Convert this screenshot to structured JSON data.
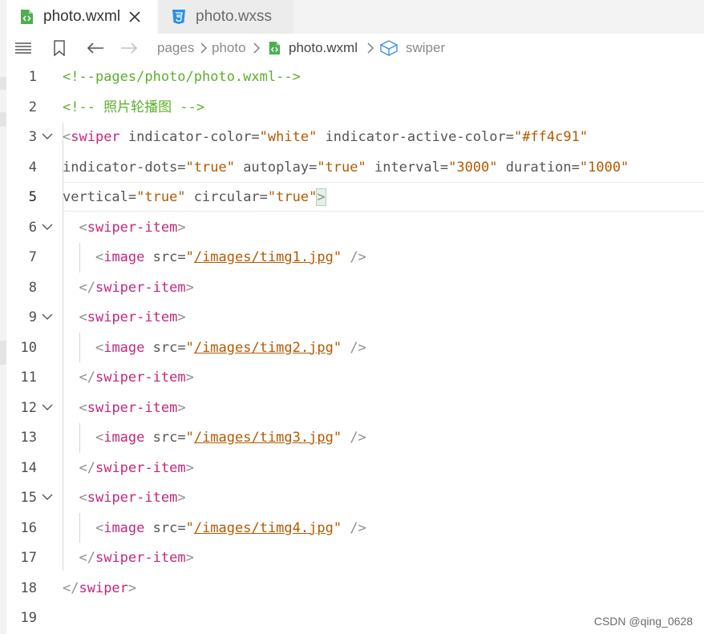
{
  "tabs": [
    {
      "label": "photo.wxml",
      "active": true,
      "icon": "wxml-file-icon"
    },
    {
      "label": "photo.wxss",
      "active": false,
      "icon": "css-file-icon"
    }
  ],
  "breadcrumb": [
    "pages",
    "photo",
    "photo.wxml",
    "swiper"
  ],
  "code_lines": [
    {
      "n": "1",
      "fold": false,
      "tokens": [
        {
          "t": "com",
          "v": "<!--pages/photo/photo.wxml-->"
        }
      ]
    },
    {
      "n": "2",
      "fold": false,
      "tokens": [
        {
          "t": "com",
          "v": "<!-- 照片轮播图 -->"
        }
      ]
    },
    {
      "n": "3",
      "fold": true,
      "tokens": [
        {
          "t": "br",
          "v": "<"
        },
        {
          "t": "tag",
          "v": "swiper"
        },
        {
          "t": "attr",
          "v": " indicator-color="
        },
        {
          "t": "str",
          "v": "\"white\""
        },
        {
          "t": "attr",
          "v": " indicator-active-color="
        },
        {
          "t": "str",
          "v": "\"#ff4c91\""
        }
      ]
    },
    {
      "n": "4",
      "fold": false,
      "tokens": [
        {
          "t": "attr",
          "v": "indicator-dots="
        },
        {
          "t": "str",
          "v": "\"true\""
        },
        {
          "t": "attr",
          "v": " autoplay="
        },
        {
          "t": "str",
          "v": "\"true\""
        },
        {
          "t": "attr",
          "v": " interval="
        },
        {
          "t": "str",
          "v": "\"3000\""
        },
        {
          "t": "attr",
          "v": " duration="
        },
        {
          "t": "str",
          "v": "\"1000\""
        }
      ]
    },
    {
      "n": "5",
      "fold": false,
      "tokens": [
        {
          "t": "attr",
          "v": "vertical="
        },
        {
          "t": "str",
          "v": "\"true\""
        },
        {
          "t": "attr",
          "v": " circular="
        },
        {
          "t": "str",
          "v": "\"true\""
        },
        {
          "t": "brm",
          "v": ">"
        }
      ]
    },
    {
      "n": "6",
      "fold": true,
      "tokens": [
        {
          "t": "sp",
          "v": "  "
        },
        {
          "t": "br",
          "v": "<"
        },
        {
          "t": "tag",
          "v": "swiper-item"
        },
        {
          "t": "br",
          "v": ">"
        }
      ]
    },
    {
      "n": "7",
      "fold": false,
      "tokens": [
        {
          "t": "sp",
          "v": "    "
        },
        {
          "t": "br",
          "v": "<"
        },
        {
          "t": "tag",
          "v": "image"
        },
        {
          "t": "attr",
          "v": " src="
        },
        {
          "t": "str",
          "v": "\""
        },
        {
          "t": "link",
          "v": "/images/timg1.jpg"
        },
        {
          "t": "str",
          "v": "\""
        },
        {
          "t": "br",
          "v": " />"
        }
      ]
    },
    {
      "n": "8",
      "fold": false,
      "tokens": [
        {
          "t": "sp",
          "v": "  "
        },
        {
          "t": "br",
          "v": "</"
        },
        {
          "t": "tag",
          "v": "swiper-item"
        },
        {
          "t": "br",
          "v": ">"
        }
      ]
    },
    {
      "n": "9",
      "fold": true,
      "tokens": [
        {
          "t": "sp",
          "v": "  "
        },
        {
          "t": "br",
          "v": "<"
        },
        {
          "t": "tag",
          "v": "swiper-item"
        },
        {
          "t": "br",
          "v": ">"
        }
      ]
    },
    {
      "n": "10",
      "fold": false,
      "tokens": [
        {
          "t": "sp",
          "v": "    "
        },
        {
          "t": "br",
          "v": "<"
        },
        {
          "t": "tag",
          "v": "image"
        },
        {
          "t": "attr",
          "v": " src="
        },
        {
          "t": "str",
          "v": "\""
        },
        {
          "t": "link",
          "v": "/images/timg2.jpg"
        },
        {
          "t": "str",
          "v": "\""
        },
        {
          "t": "br",
          "v": " />"
        }
      ]
    },
    {
      "n": "11",
      "fold": false,
      "tokens": [
        {
          "t": "sp",
          "v": "  "
        },
        {
          "t": "br",
          "v": "</"
        },
        {
          "t": "tag",
          "v": "swiper-item"
        },
        {
          "t": "br",
          "v": ">"
        }
      ]
    },
    {
      "n": "12",
      "fold": true,
      "tokens": [
        {
          "t": "sp",
          "v": "  "
        },
        {
          "t": "br",
          "v": "<"
        },
        {
          "t": "tag",
          "v": "swiper-item"
        },
        {
          "t": "br",
          "v": ">"
        }
      ]
    },
    {
      "n": "13",
      "fold": false,
      "tokens": [
        {
          "t": "sp",
          "v": "    "
        },
        {
          "t": "br",
          "v": "<"
        },
        {
          "t": "tag",
          "v": "image"
        },
        {
          "t": "attr",
          "v": " src="
        },
        {
          "t": "str",
          "v": "\""
        },
        {
          "t": "link",
          "v": "/images/timg3.jpg"
        },
        {
          "t": "str",
          "v": "\""
        },
        {
          "t": "br",
          "v": " />"
        }
      ]
    },
    {
      "n": "14",
      "fold": false,
      "tokens": [
        {
          "t": "sp",
          "v": "  "
        },
        {
          "t": "br",
          "v": "</"
        },
        {
          "t": "tag",
          "v": "swiper-item"
        },
        {
          "t": "br",
          "v": ">"
        }
      ]
    },
    {
      "n": "15",
      "fold": true,
      "tokens": [
        {
          "t": "sp",
          "v": "  "
        },
        {
          "t": "br",
          "v": "<"
        },
        {
          "t": "tag",
          "v": "swiper-item"
        },
        {
          "t": "br",
          "v": ">"
        }
      ]
    },
    {
      "n": "16",
      "fold": false,
      "tokens": [
        {
          "t": "sp",
          "v": "    "
        },
        {
          "t": "br",
          "v": "<"
        },
        {
          "t": "tag",
          "v": "image"
        },
        {
          "t": "attr",
          "v": " src="
        },
        {
          "t": "str",
          "v": "\""
        },
        {
          "t": "link",
          "v": "/images/timg4.jpg"
        },
        {
          "t": "str",
          "v": "\""
        },
        {
          "t": "br",
          "v": " />"
        }
      ]
    },
    {
      "n": "17",
      "fold": false,
      "tokens": [
        {
          "t": "sp",
          "v": "  "
        },
        {
          "t": "br",
          "v": "</"
        },
        {
          "t": "tag",
          "v": "swiper-item"
        },
        {
          "t": "br",
          "v": ">"
        }
      ]
    },
    {
      "n": "18",
      "fold": false,
      "tokens": [
        {
          "t": "br",
          "v": "</"
        },
        {
          "t": "tag",
          "v": "swiper"
        },
        {
          "t": "br",
          "v": ">"
        }
      ]
    },
    {
      "n": "19",
      "fold": false,
      "tokens": []
    }
  ],
  "current_line": "5",
  "watermark": "CSDN @qing_0628",
  "colors": {
    "comment": "#5fae2f",
    "tag": "#c4277b",
    "string": "#b35a00",
    "attribute": "#555555",
    "bracket": "#8f8f8f",
    "wxml_icon": "#4caf50",
    "css_icon": "#2b8fe6"
  }
}
